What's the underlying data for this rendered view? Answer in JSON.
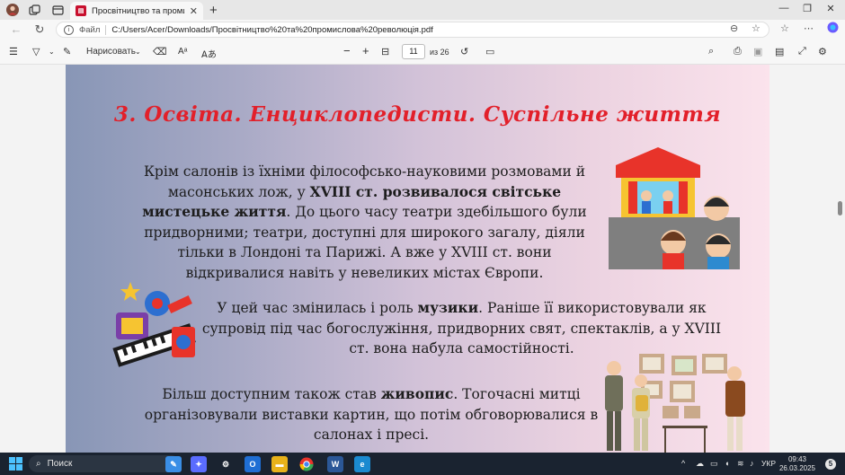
{
  "browser": {
    "tab": {
      "title": "Просвітництво та промислова р",
      "icon": "pdf-icon"
    },
    "address": {
      "scheme_label": "Файл",
      "url": "C:/Users/Acer/Downloads/Просвітництво%20та%20промислова%20революція.pdf"
    }
  },
  "pdf_toolbar": {
    "draw_label": "Нарисовать",
    "zoom_out": "−",
    "zoom_in": "+",
    "current_page": "11",
    "page_total": "из 26"
  },
  "slide": {
    "title": "3. Освіта. Енциклопедисти. Суспільне життя",
    "p1": {
      "a": "Крім салонів із їхніми філософсько-науковими розмовами й масонських лож, у ",
      "b": "XVIII ст. розвивалося світське мистецьке життя",
      "c": ". До цього часу театри здебільшого були придворними; театри, доступні для широкого загалу, діяли тільки в Лондоні та Парижі. А вже у XVIII ст. вони відкривалися навіть у невеликих містах Європи."
    },
    "p2": {
      "a": "У цей час змінилась і роль ",
      "b": "музики",
      "c": ". Раніше її використовували як супровід під час богослужіння, придворних свят, спектаклів, а у XVIII ст. вона набула самостійності."
    },
    "p3": {
      "a": "Більш доступним також став ",
      "b": "живопис",
      "c": ". Тогочасні митці організовували виставки картин, що потім обговорювалися в салонах і пресі."
    }
  },
  "taskbar": {
    "search_label": "Поиск",
    "language": "УКР",
    "time": "09:43",
    "date": "26.03.2025",
    "notification_count": "5"
  },
  "colors": {
    "title_red": "#e2202a",
    "taskbar": "#1a2330"
  }
}
